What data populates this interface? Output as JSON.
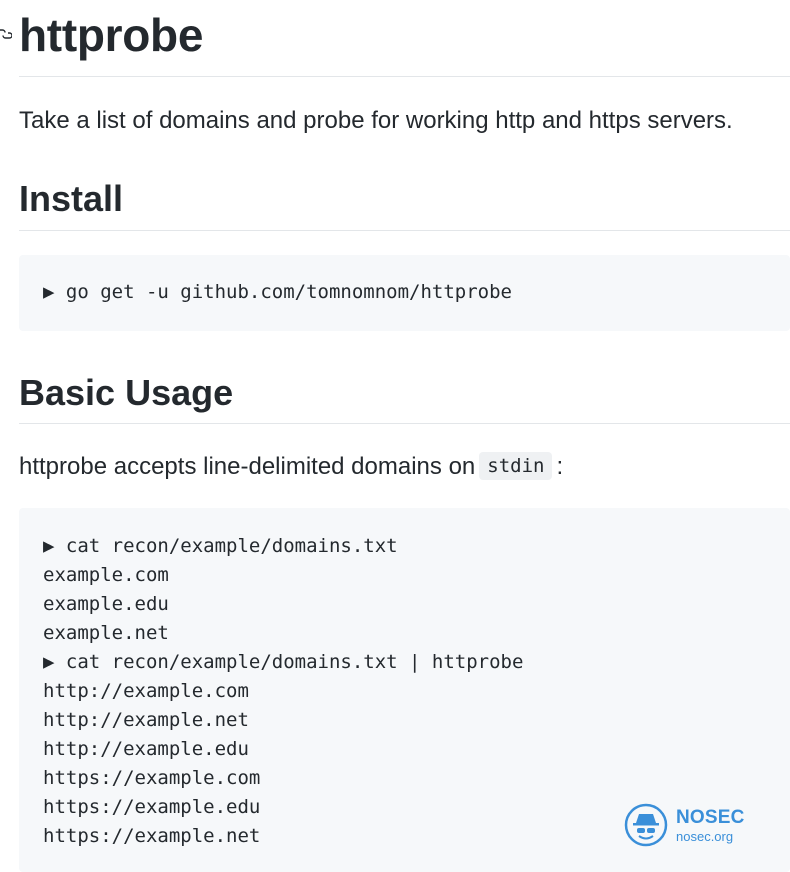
{
  "page": {
    "title": "httprobe",
    "description": "Take a list of domains and probe for working http and https servers."
  },
  "install": {
    "heading": "Install",
    "code_lines": [
      "▶ go get -u github.com/tomnomnom/httprobe"
    ]
  },
  "usage": {
    "heading": "Basic Usage",
    "intro_before": "httprobe accepts line-delimited domains on",
    "intro_code": "stdin",
    "intro_after": ":",
    "code_lines": [
      "▶ cat recon/example/domains.txt",
      "example.com",
      "example.edu",
      "example.net",
      "▶ cat recon/example/domains.txt | httprobe",
      "http://example.com",
      "http://example.net",
      "http://example.edu",
      "https://example.com",
      "https://example.edu",
      "https://example.net"
    ]
  },
  "watermark": {
    "name": "NOSEC",
    "site": "nosec.org",
    "logo_icon": "spy-hat-icon",
    "color": "#3a8fd9"
  },
  "colors": {
    "text": "#24292e",
    "code_background": "#f6f8fa",
    "rule": "#e3e6e9"
  }
}
